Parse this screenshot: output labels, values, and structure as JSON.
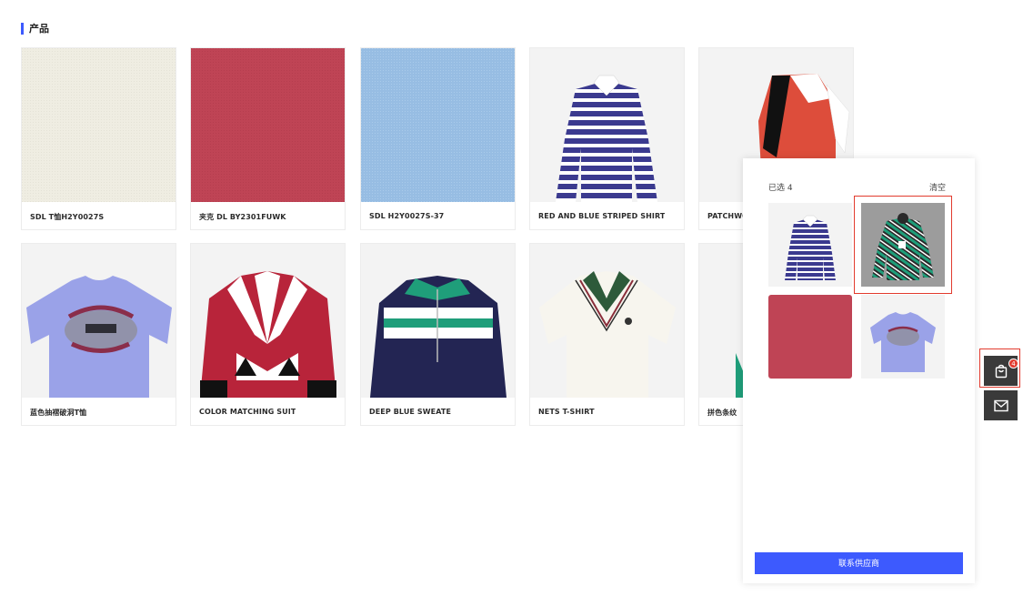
{
  "section": {
    "title": "产品"
  },
  "products": [
    {
      "label": "SDL T恤H2Y0027S",
      "image": "cream-fabric"
    },
    {
      "label": "夹克 DL BY2301FUWK",
      "image": "red-fabric"
    },
    {
      "label": "SDL H2Y0027S-37",
      "image": "blue-fabric"
    },
    {
      "label": "RED AND BLUE STRIPED SHIRT",
      "image": "striped-shirt"
    },
    {
      "label": "PATCHWORK",
      "image": "patchwork-skirt"
    },
    {
      "label": "蓝色抽褶破洞T恤",
      "image": "blue-tshirt"
    },
    {
      "label": "COLOR MATCHING SUIT",
      "image": "color-suit"
    },
    {
      "label": "DEEP BLUE SWEATE",
      "image": "deep-blue-sweater"
    },
    {
      "label": "NETS T-SHIRT",
      "image": "nets-tshirt"
    },
    {
      "label": "拼色条纹",
      "image": "green-striped-shirt"
    }
  ],
  "panel": {
    "count_label": "已选 4",
    "clear_label": "清空",
    "contact_label": "联系供应商",
    "selected": [
      "striped-shirt",
      "green-striped-shirt",
      "red-fabric",
      "blue-tshirt"
    ]
  },
  "floating": {
    "cart_icon": "shopping-bag-icon",
    "mail_icon": "mail-icon",
    "cart_badge": "4"
  },
  "colors": {
    "accent": "#3d5afe",
    "highlight": "#e23b2e",
    "cream": "#efede2",
    "red": "#bf4455",
    "blue": "#97bde3"
  }
}
